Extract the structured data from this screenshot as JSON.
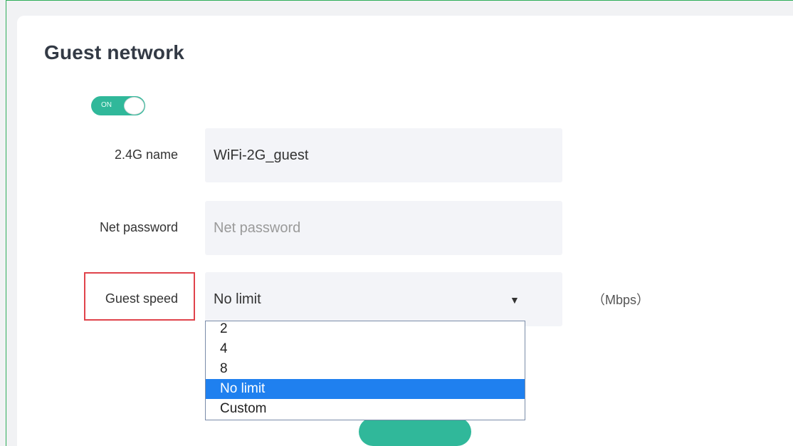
{
  "page": {
    "title": "Guest network"
  },
  "toggle": {
    "label": "ON",
    "state": true
  },
  "fields": {
    "name_24g": {
      "label": "2.4G name",
      "value": "WiFi-2G_guest"
    },
    "password": {
      "label": "Net password",
      "placeholder": "Net password",
      "value": ""
    },
    "guest_speed": {
      "label": "Guest speed",
      "value": "No limit",
      "arrow": "▼",
      "unit": "（Mbps）"
    }
  },
  "speed_options": [
    "2",
    "4",
    "8",
    "No limit",
    "Custom"
  ],
  "colors": {
    "accent": "#30b89a",
    "selected": "#1f80ef",
    "highlight": "#e0434b"
  }
}
